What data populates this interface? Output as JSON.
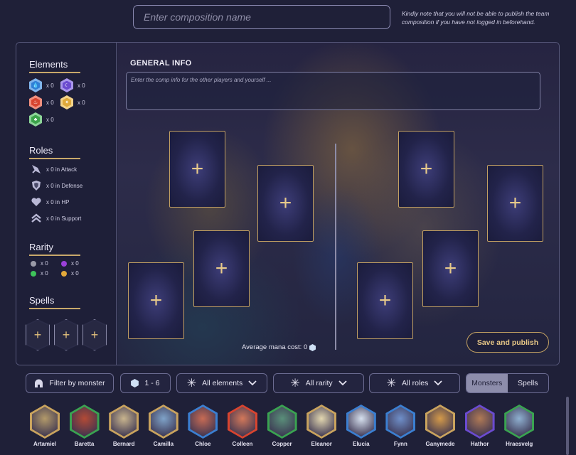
{
  "header": {
    "composition_placeholder": "Enter composition name",
    "login_note": "Kindly note that you will not be able to publish the team composition if you have not logged in beforehand."
  },
  "sidebar": {
    "elements_title": "Elements",
    "elements": [
      {
        "icon": "water-icon",
        "count": "x 0",
        "color": "#2f7fd6"
      },
      {
        "icon": "dark-icon",
        "count": "x 0",
        "color": "#6b4bd0"
      },
      {
        "icon": "fire-icon",
        "count": "x 0",
        "color": "#d8442f"
      },
      {
        "icon": "light-icon",
        "count": "x 0",
        "color": "#e0a93a"
      },
      {
        "icon": "nature-icon",
        "count": "x 0",
        "color": "#3ba34a"
      }
    ],
    "roles_title": "Roles",
    "roles": [
      {
        "icon": "attack-icon",
        "label": "x 0 in Attack"
      },
      {
        "icon": "defense-icon",
        "label": "x 0 in Defense"
      },
      {
        "icon": "hp-icon",
        "label": "x 0 in HP"
      },
      {
        "icon": "support-icon",
        "label": "x 0 in Support"
      }
    ],
    "rarity_title": "Rarity",
    "rarity": [
      {
        "count": "x 0",
        "color": "#9a9aa8"
      },
      {
        "count": "x 0",
        "color": "#9b40d8"
      },
      {
        "count": "x 0",
        "color": "#3ec35a"
      },
      {
        "count": "x 0",
        "color": "#e2a83a"
      }
    ],
    "spells_title": "Spells",
    "spell_slots": [
      "+",
      "+",
      "+"
    ]
  },
  "board": {
    "title": "GENERAL INFO",
    "info_placeholder": "Enter the comp info for the other players and yourself ...",
    "slot_symbol": "+",
    "mana_label": "Average mana cost: 0",
    "save_label": "Save and publish"
  },
  "toolbar": {
    "filter_monster": "Filter by monster",
    "range": "1 - 6",
    "elements": "All elements",
    "rarity": "All rarity",
    "roles": "All roles",
    "tab_monsters": "Monsters",
    "tab_spells": "Spells"
  },
  "roster": [
    {
      "name": "Artamiel",
      "frame": "#c9a35e",
      "tone": "#b39a6a"
    },
    {
      "name": "Baretta",
      "frame": "#3aa351",
      "tone": "#b34a36"
    },
    {
      "name": "Bernard",
      "frame": "#c9a35e",
      "tone": "#c9b58e"
    },
    {
      "name": "Camilla",
      "frame": "#c9a35e",
      "tone": "#7fa3c9"
    },
    {
      "name": "Chloe",
      "frame": "#3b7fd1",
      "tone": "#c76b54"
    },
    {
      "name": "Colleen",
      "frame": "#d8442f",
      "tone": "#d3785a"
    },
    {
      "name": "Copper",
      "frame": "#3aa351",
      "tone": "#5a8f7a"
    },
    {
      "name": "Eleanor",
      "frame": "#c9a35e",
      "tone": "#e3d7b0"
    },
    {
      "name": "Elucia",
      "frame": "#3b7fd1",
      "tone": "#d6e0ee"
    },
    {
      "name": "Fynn",
      "frame": "#3b7fd1",
      "tone": "#6f8fc9"
    },
    {
      "name": "Ganymede",
      "frame": "#c9a35e",
      "tone": "#d49a4a"
    },
    {
      "name": "Hathor",
      "frame": "#6b4bd0",
      "tone": "#b07a56"
    },
    {
      "name": "Hraesvelg",
      "frame": "#3aa351",
      "tone": "#8fb0d0"
    }
  ]
}
